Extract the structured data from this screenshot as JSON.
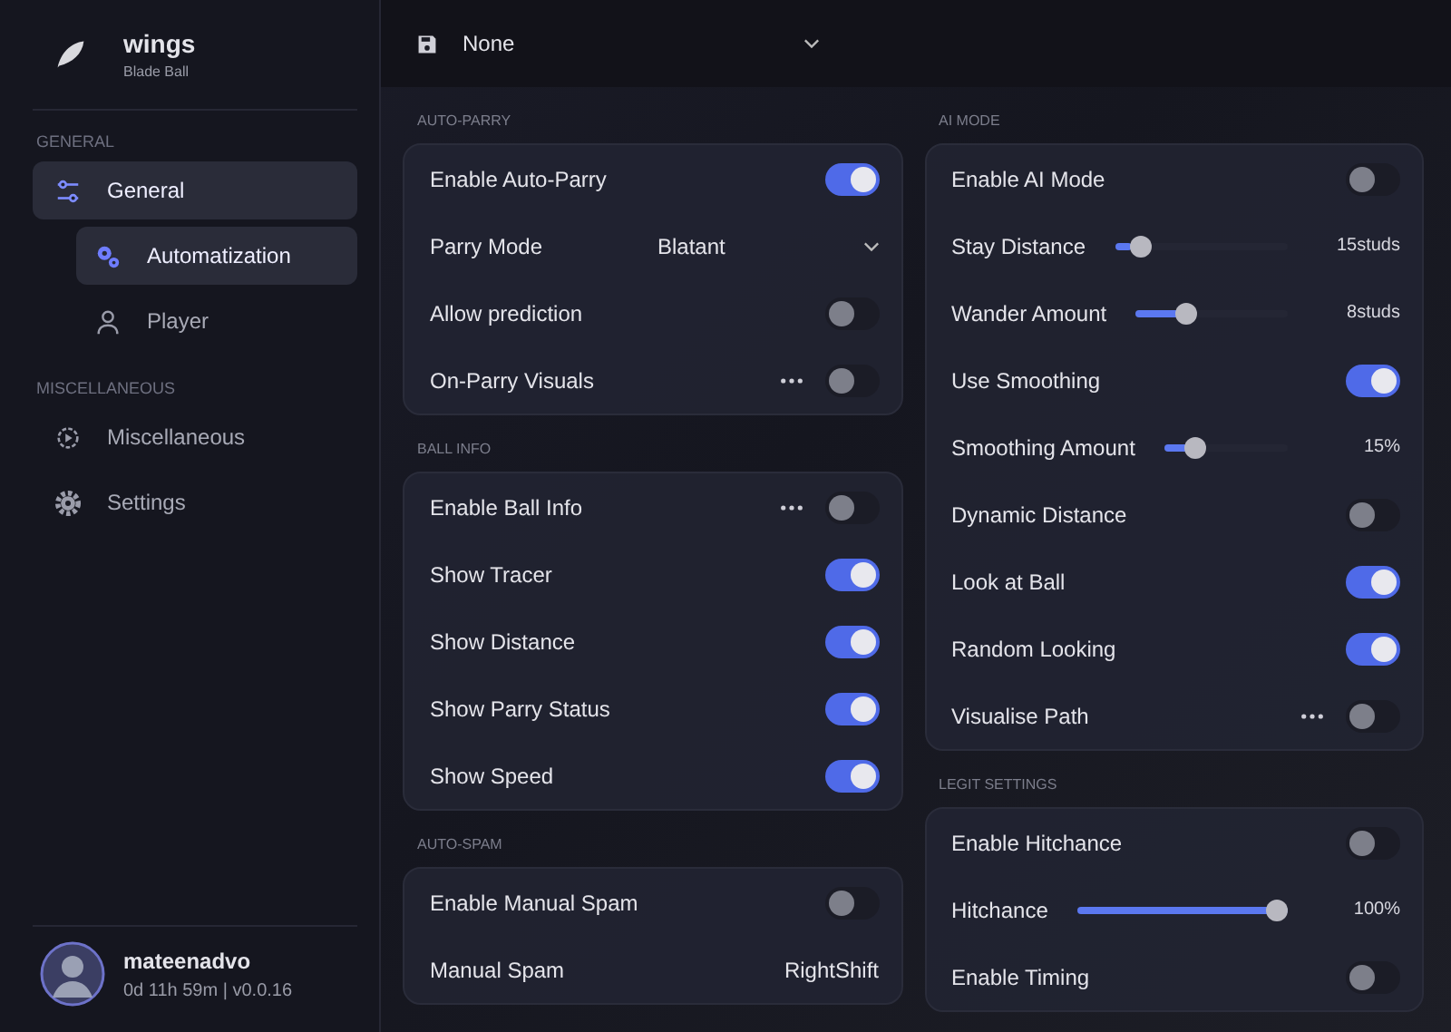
{
  "app": {
    "title": "wings",
    "subtitle": "Blade Ball"
  },
  "sidebar": {
    "groups": [
      {
        "label": "GENERAL",
        "items": [
          {
            "label": "General",
            "selected": true,
            "children": [
              {
                "label": "Automatization",
                "selected": true
              },
              {
                "label": "Player",
                "selected": false
              }
            ]
          }
        ]
      },
      {
        "label": "MISCELLANEOUS",
        "items": [
          {
            "label": "Miscellaneous",
            "selected": false
          },
          {
            "label": "Settings",
            "selected": false
          }
        ]
      }
    ]
  },
  "user": {
    "name": "mateenadvo",
    "status": "0d 11h 59m | v0.0.16"
  },
  "config_dropdown": {
    "value": "None"
  },
  "columns": [
    [
      {
        "title": "AUTO-PARRY",
        "rows": [
          {
            "kind": "toggle",
            "label": "Enable Auto-Parry",
            "on": true,
            "more": false
          },
          {
            "kind": "dropdown",
            "label": "Parry Mode",
            "value": "Blatant"
          },
          {
            "kind": "toggle",
            "label": "Allow prediction",
            "on": false,
            "more": false
          },
          {
            "kind": "toggle",
            "label": "On-Parry Visuals",
            "on": false,
            "more": true
          }
        ]
      },
      {
        "title": "BALL INFO",
        "rows": [
          {
            "kind": "toggle",
            "label": "Enable Ball Info",
            "on": false,
            "more": true
          },
          {
            "kind": "toggle",
            "label": "Show Tracer",
            "on": true,
            "more": false
          },
          {
            "kind": "toggle",
            "label": "Show Distance",
            "on": true,
            "more": false
          },
          {
            "kind": "toggle",
            "label": "Show Parry Status",
            "on": true,
            "more": false
          },
          {
            "kind": "toggle",
            "label": "Show Speed",
            "on": true,
            "more": false
          }
        ]
      },
      {
        "title": "AUTO-SPAM",
        "rows": [
          {
            "kind": "toggle",
            "label": "Enable Manual Spam",
            "on": false,
            "more": false
          },
          {
            "kind": "keybind",
            "label": "Manual Spam",
            "value": "RightShift"
          }
        ]
      }
    ],
    [
      {
        "title": "AI MODE",
        "rows": [
          {
            "kind": "toggle",
            "label": "Enable AI Mode",
            "on": false,
            "more": false
          },
          {
            "kind": "slider",
            "label": "Stay Distance",
            "level": 0.1,
            "reading": "15studs"
          },
          {
            "kind": "slider",
            "label": "Wander Amount",
            "level": 0.3,
            "reading": "8studs"
          },
          {
            "kind": "toggle",
            "label": "Use Smoothing",
            "on": true,
            "more": false
          },
          {
            "kind": "slider",
            "label": "Smoothing Amount",
            "level": 0.2,
            "reading": "15%"
          },
          {
            "kind": "toggle",
            "label": "Dynamic Distance",
            "on": false,
            "more": false
          },
          {
            "kind": "toggle",
            "label": "Look at Ball",
            "on": true,
            "more": false
          },
          {
            "kind": "toggle",
            "label": "Random Looking",
            "on": true,
            "more": false
          },
          {
            "kind": "toggle",
            "label": "Visualise Path",
            "on": false,
            "more": true
          }
        ]
      },
      {
        "title": "LEGIT SETTINGS",
        "rows": [
          {
            "kind": "toggle",
            "label": "Enable Hitchance",
            "on": false,
            "more": false
          },
          {
            "kind": "slider",
            "label": "Hitchance",
            "level": 1.0,
            "reading": "100%"
          },
          {
            "kind": "toggle",
            "label": "Enable Timing",
            "on": false,
            "more": false
          }
        ]
      }
    ]
  ]
}
